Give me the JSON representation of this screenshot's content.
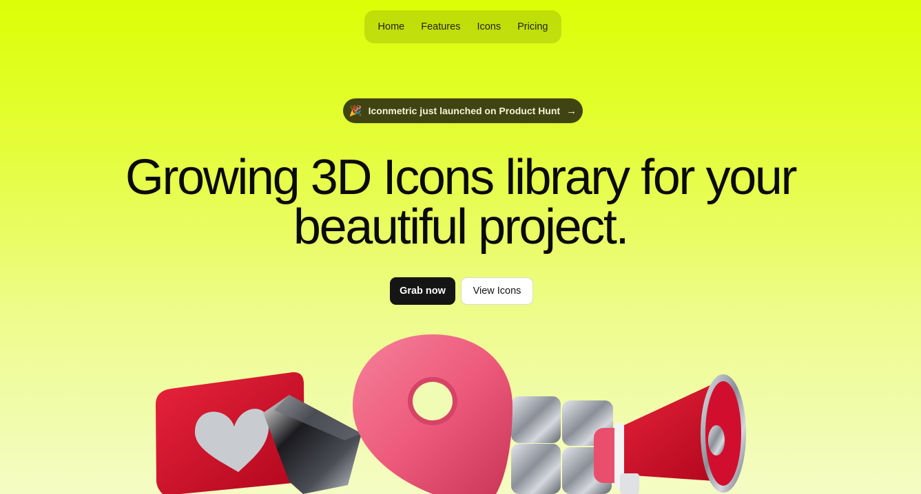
{
  "nav": {
    "items": [
      "Home",
      "Features",
      "Icons",
      "Pricing"
    ]
  },
  "announcement": {
    "emoji": "🎉",
    "text": "Iconmetric just launched on Product Hunt",
    "arrow": "→"
  },
  "hero": {
    "line1": "Growing 3D Icons library for your",
    "line2": "beautiful project."
  },
  "buttons": {
    "primary": "Grab now",
    "secondary": "View Icons"
  },
  "illustration": {
    "icons": [
      "heart-like-icon",
      "glass-prism-icon",
      "location-pin-icon",
      "chrome-cubes-icon",
      "megaphone-icon"
    ]
  }
}
